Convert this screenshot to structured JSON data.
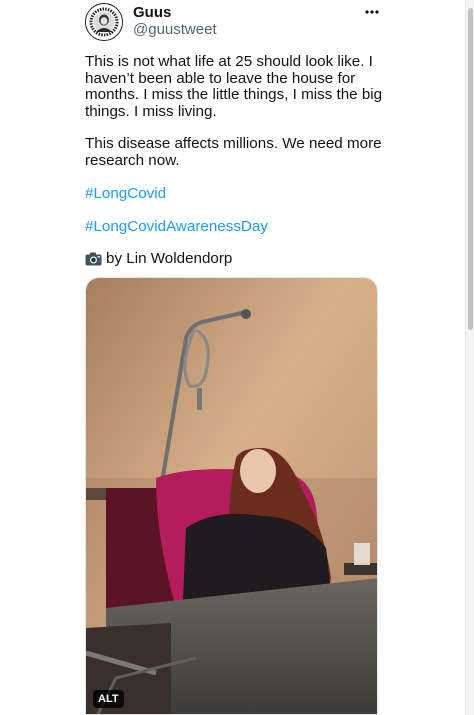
{
  "author": {
    "display_name": "Guus",
    "handle": "@guustweet"
  },
  "more_icon": "more-horizontal-icon",
  "tweet": {
    "line1": "This is not what life at 25 should look like. I haven’t been able to leave the house for months. I miss the little things, I miss the big things. I miss living.",
    "line2": "This disease affects millions. We need more research now.",
    "hashtag1": "#LongCovid",
    "hashtag2": "#LongCovidAwarenessDay",
    "credit": "by Lin Woldendorp",
    "credit_icon": "camera-icon"
  },
  "media": {
    "alt_label": "ALT"
  },
  "colors": {
    "link": "#1d9bf0",
    "text": "#0f1419",
    "secondary": "#536471"
  }
}
